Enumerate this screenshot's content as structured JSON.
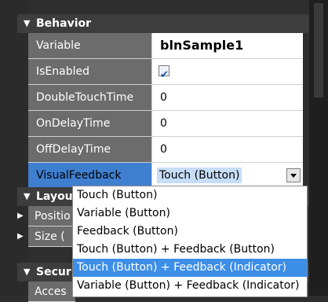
{
  "sections": {
    "behavior": "Behavior",
    "layout": "Layou",
    "security": "Secur"
  },
  "rows": {
    "variable": {
      "name": "Variable",
      "value": "blnSample1"
    },
    "isenabled": {
      "name": "IsEnabled",
      "checked": true
    },
    "doubletouch": {
      "name": "DoubleTouchTime",
      "value": "0"
    },
    "ondelay": {
      "name": "OnDelayTime",
      "value": "0"
    },
    "offdelay": {
      "name": "OffDelayTime",
      "value": "0"
    },
    "visualfeedback": {
      "name": "VisualFeedback",
      "value": "Touch (Button)"
    }
  },
  "layout_rows": {
    "position": "Positio",
    "size": "Size ("
  },
  "security_rows": {
    "access": "Acces"
  },
  "dropdown": {
    "options": [
      "Touch (Button)",
      "Variable (Button)",
      "Feedback (Button)",
      "Touch (Button) + Feedback (Button)",
      "Touch (Button) + Feedback (Indicator)",
      "Variable (Button) + Feedback (Indicator)"
    ],
    "highlighted_index": 4
  },
  "icons": [
    "collapse-arrow-icon",
    "expand-arrow-icon",
    "checkbox-checked-icon",
    "dropdown-arrow-icon"
  ],
  "colors": {
    "panel_bg": "#2e2e2e",
    "name_cell": "#6c6c6c",
    "selection": "#3f7fd0",
    "highlight": "#3d8ee6"
  }
}
